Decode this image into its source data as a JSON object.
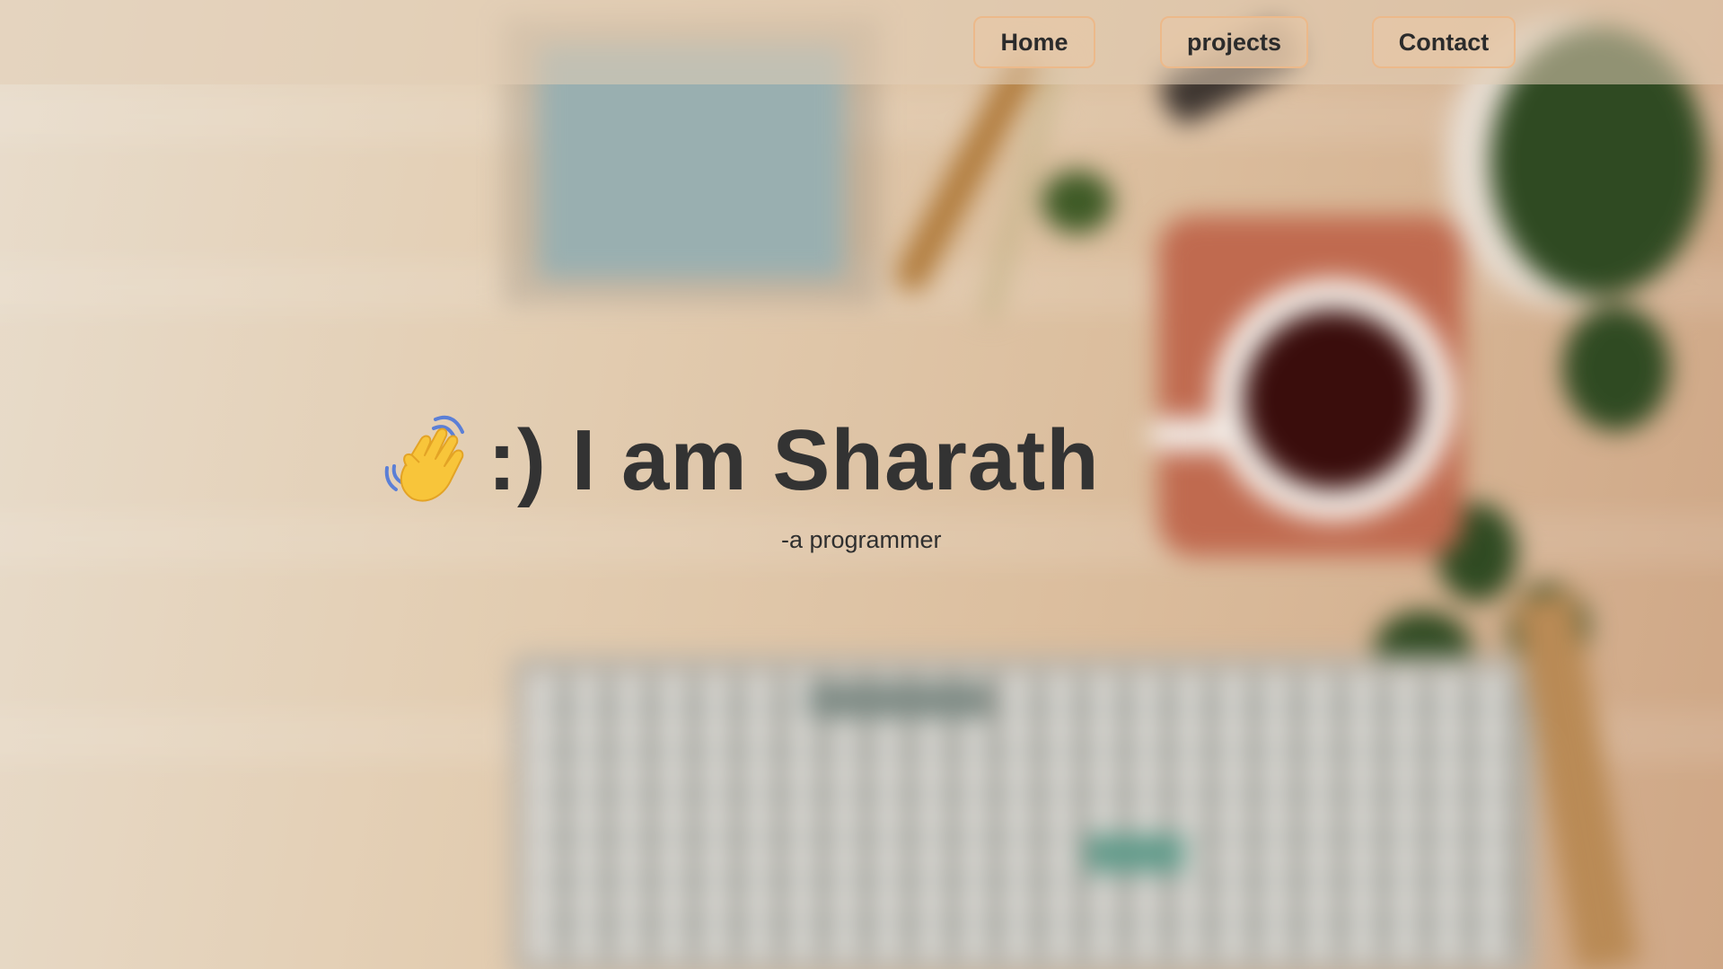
{
  "nav": {
    "items": [
      {
        "label": "Home"
      },
      {
        "label": "projects"
      },
      {
        "label": "Contact"
      }
    ]
  },
  "hero": {
    "icon": "waving-hand-icon",
    "title": ":) I am Sharath",
    "subtitle": "-a programmer"
  },
  "colors": {
    "text": "#333333",
    "nav_button_border": "#ecb98a",
    "nav_button_fill": "#e6c7a8",
    "navbar_bg": "#e2cdb7"
  }
}
